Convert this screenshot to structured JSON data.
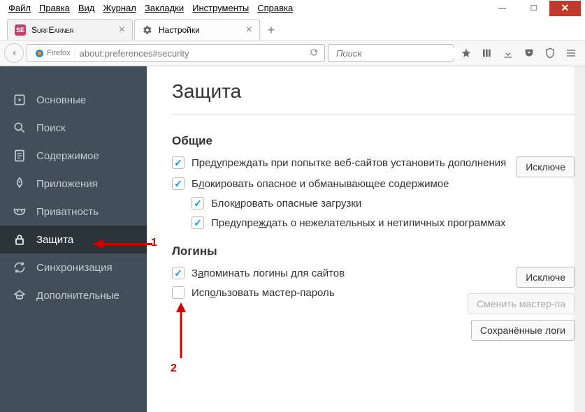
{
  "menu": [
    "Файл",
    "Правка",
    "Вид",
    "Журнал",
    "Закладки",
    "Инструменты",
    "Справка"
  ],
  "tabs": [
    {
      "title": "SurfEarner",
      "favicon": "surf"
    },
    {
      "title": "Настройки",
      "favicon": "settings"
    }
  ],
  "url": {
    "identity_label": "Firefox",
    "value": "about:preferences#security"
  },
  "search": {
    "placeholder": "Поиск"
  },
  "sidebar": {
    "items": [
      {
        "label": "Основные",
        "icon": "square"
      },
      {
        "label": "Поиск",
        "icon": "search"
      },
      {
        "label": "Содержимое",
        "icon": "doc"
      },
      {
        "label": "Приложения",
        "icon": "rocket"
      },
      {
        "label": "Приватность",
        "icon": "mask"
      },
      {
        "label": "Защита",
        "icon": "lock",
        "active": true
      },
      {
        "label": "Синхронизация",
        "icon": "sync"
      },
      {
        "label": "Дополнительные",
        "icon": "hat"
      }
    ]
  },
  "page": {
    "title": "Защита",
    "sections": {
      "general": {
        "title": "Общие",
        "chk_warn": "Предупреждать при попытке веб-сайтов установить дополнения",
        "btn_excl": "Исключе",
        "chk_block": "Блокировать опасное и обманывающее содержимое",
        "chk_downloads": "Блокировать опасные загрузки",
        "chk_unwanted": "Предупреждать о нежелательных и нетипичных программах"
      },
      "logins": {
        "title": "Логины",
        "chk_remember": "Запоминать логины для сайтов",
        "btn_excl": "Исключе",
        "chk_master": "Использовать мастер-пароль",
        "btn_change": "Сменить мастер-па",
        "btn_saved": "Сохранённые логи"
      }
    }
  },
  "annotations": {
    "one": "1",
    "two": "2"
  }
}
